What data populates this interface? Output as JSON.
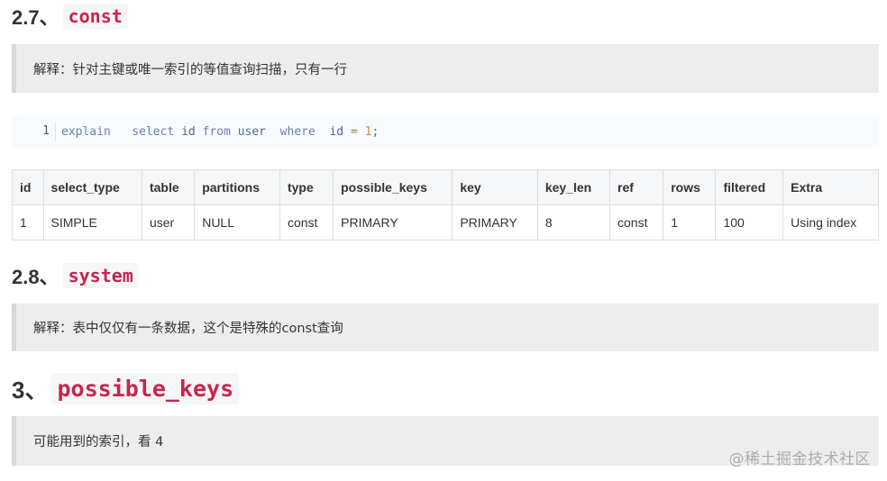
{
  "section_2_7": {
    "number": "2.7、",
    "keyword": "const",
    "note": "解释：针对主键或唯一索引的等值查询扫描，只有一行"
  },
  "code_example": {
    "line_number": "1",
    "tokens": {
      "explain": "explain",
      "select": "select",
      "id1": "id",
      "from": "from",
      "table": "user",
      "where": "where",
      "id2": "id",
      "eq": "=",
      "value": "1",
      "semicolon": ";"
    }
  },
  "plan_table": {
    "headers": [
      "id",
      "select_type",
      "table",
      "partitions",
      "type",
      "possible_keys",
      "key",
      "key_len",
      "ref",
      "rows",
      "filtered",
      "Extra"
    ],
    "rows": [
      [
        "1",
        "SIMPLE",
        "user",
        "NULL",
        "const",
        "PRIMARY",
        "PRIMARY",
        "8",
        "const",
        "1",
        "100",
        "Using index"
      ]
    ]
  },
  "section_2_8": {
    "number": "2.8、",
    "keyword": "system",
    "note": "解释：表中仅仅有一条数据，这个是特殊的const查询"
  },
  "section_3": {
    "number": "3、",
    "keyword": "possible_keys",
    "note": "可能用到的索引，看 4"
  },
  "watermark": "@稀土掘金技术社区"
}
